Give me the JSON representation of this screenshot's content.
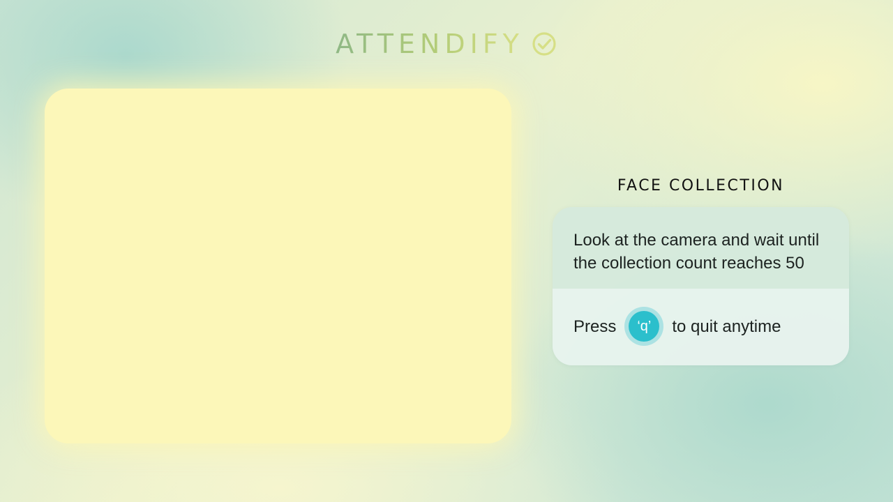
{
  "brand": {
    "title": "ATTENDIFY",
    "icon": "check-circle-icon"
  },
  "camera": {
    "feed": "camera-feed"
  },
  "face_collection": {
    "title": "FACE COLLECTION",
    "instruction": "Look at the camera and wait until the collection count reaches 50",
    "press_label": "Press",
    "key": "‘q’",
    "quit_label": "to quit anytime"
  },
  "colors": {
    "camera_panel": "#fcf7b9",
    "key_badge": "#2bbfcc",
    "brand_gradient_start": "#8fb885",
    "brand_gradient_end": "#d7df86"
  }
}
